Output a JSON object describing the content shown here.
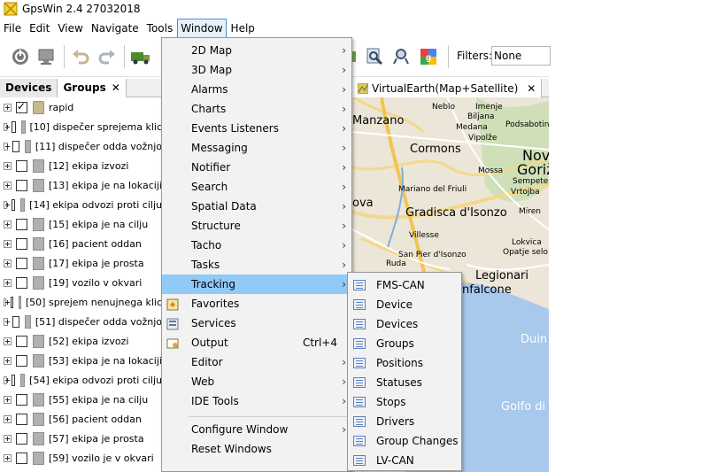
{
  "app": {
    "title": "GpsWin 2.4 27032018"
  },
  "menubar": [
    "File",
    "Edit",
    "View",
    "Navigate",
    "Tools",
    "Window",
    "Help"
  ],
  "toolbar": {
    "filters_label": "Filters:",
    "filters_value": "None"
  },
  "left_panel": {
    "tabs": [
      {
        "label": "Devices"
      },
      {
        "label": "Groups",
        "close": "✕"
      }
    ],
    "rows": [
      {
        "label": "rapid",
        "checked": true,
        "icon": "lock-icon"
      },
      {
        "label": "[10] dispečer sprejema klic"
      },
      {
        "label": "[11] dispečer odda vožnjo"
      },
      {
        "label": "[12] ekipa izvozi"
      },
      {
        "label": "[13] ekipa je na lokaciji"
      },
      {
        "label": "[14] ekipa odvozi proti cilju"
      },
      {
        "label": "[15] ekipa je na cilju"
      },
      {
        "label": "[16] pacient oddan"
      },
      {
        "label": "[17] ekipa je prosta"
      },
      {
        "label": "[19] vozilo v okvari"
      },
      {
        "label": "[50] sprejem nenujnega klic"
      },
      {
        "label": "[51] dispečer odda vožnjo"
      },
      {
        "label": "[52] ekipa izvozi"
      },
      {
        "label": "[53] ekipa je na lokaciji"
      },
      {
        "label": "[54] ekipa odvozi proti cilju"
      },
      {
        "label": "[55] ekipa je na cilju"
      },
      {
        "label": "[56] pacient oddan"
      },
      {
        "label": "[57] ekipa je prosta"
      },
      {
        "label": "[59] vozilo je v okvari"
      }
    ]
  },
  "map": {
    "tab_label": "VirtualEarth(Map+Satellite)",
    "tab_close": "✕",
    "labels": [
      "Neblo",
      "Imenje",
      "Biljana",
      "Medana",
      "Vipolže",
      "Podsabotin",
      "Manzano",
      "Cormons",
      "Nova",
      "Goriž",
      "Mossa",
      "Sempeter",
      "Mariano del Friuli",
      "Vrtojba",
      "ova",
      "Gradisca d'Isonzo",
      "Miren",
      "Villesse",
      "Lokvica",
      "Opatje selo",
      "San Pier d'Isonzo",
      "Ruda",
      "Legionari",
      "nfalcone",
      "Duin",
      "Golfo di"
    ]
  },
  "window_menu": {
    "items": [
      {
        "label": "2D Map",
        "arrow": "›"
      },
      {
        "label": "3D Map",
        "arrow": "›"
      },
      {
        "label": "Alarms",
        "arrow": "›"
      },
      {
        "label": "Charts",
        "arrow": "›"
      },
      {
        "label": "Events Listeners",
        "arrow": "›"
      },
      {
        "label": "Messaging",
        "arrow": "›"
      },
      {
        "label": "Notifier",
        "arrow": "›"
      },
      {
        "label": "Search",
        "arrow": "›"
      },
      {
        "label": "Spatial Data",
        "arrow": "›"
      },
      {
        "label": "Structure",
        "arrow": "›"
      },
      {
        "label": "Tacho",
        "arrow": "›"
      },
      {
        "label": "Tasks",
        "arrow": "›"
      },
      {
        "label": "Tracking",
        "arrow": "›",
        "highlight": true
      },
      {
        "label": "Favorites",
        "icon": "favorites-icon"
      },
      {
        "label": "Services",
        "icon": "services-icon"
      },
      {
        "label": "Output",
        "icon": "output-icon",
        "shortcut": "Ctrl+4"
      },
      {
        "label": "Editor",
        "arrow": "›"
      },
      {
        "label": "Web",
        "arrow": "›"
      },
      {
        "label": "IDE Tools",
        "arrow": "›"
      },
      {
        "label": "Configure Window",
        "arrow": "›",
        "sep_before": true
      },
      {
        "label": "Reset Windows"
      }
    ]
  },
  "tracking_submenu": {
    "items": [
      "FMS-CAN",
      "Device",
      "Devices",
      "Groups",
      "Positions",
      "Statuses",
      "Stops",
      "Drivers",
      "Group Changes",
      "LV-CAN"
    ]
  }
}
